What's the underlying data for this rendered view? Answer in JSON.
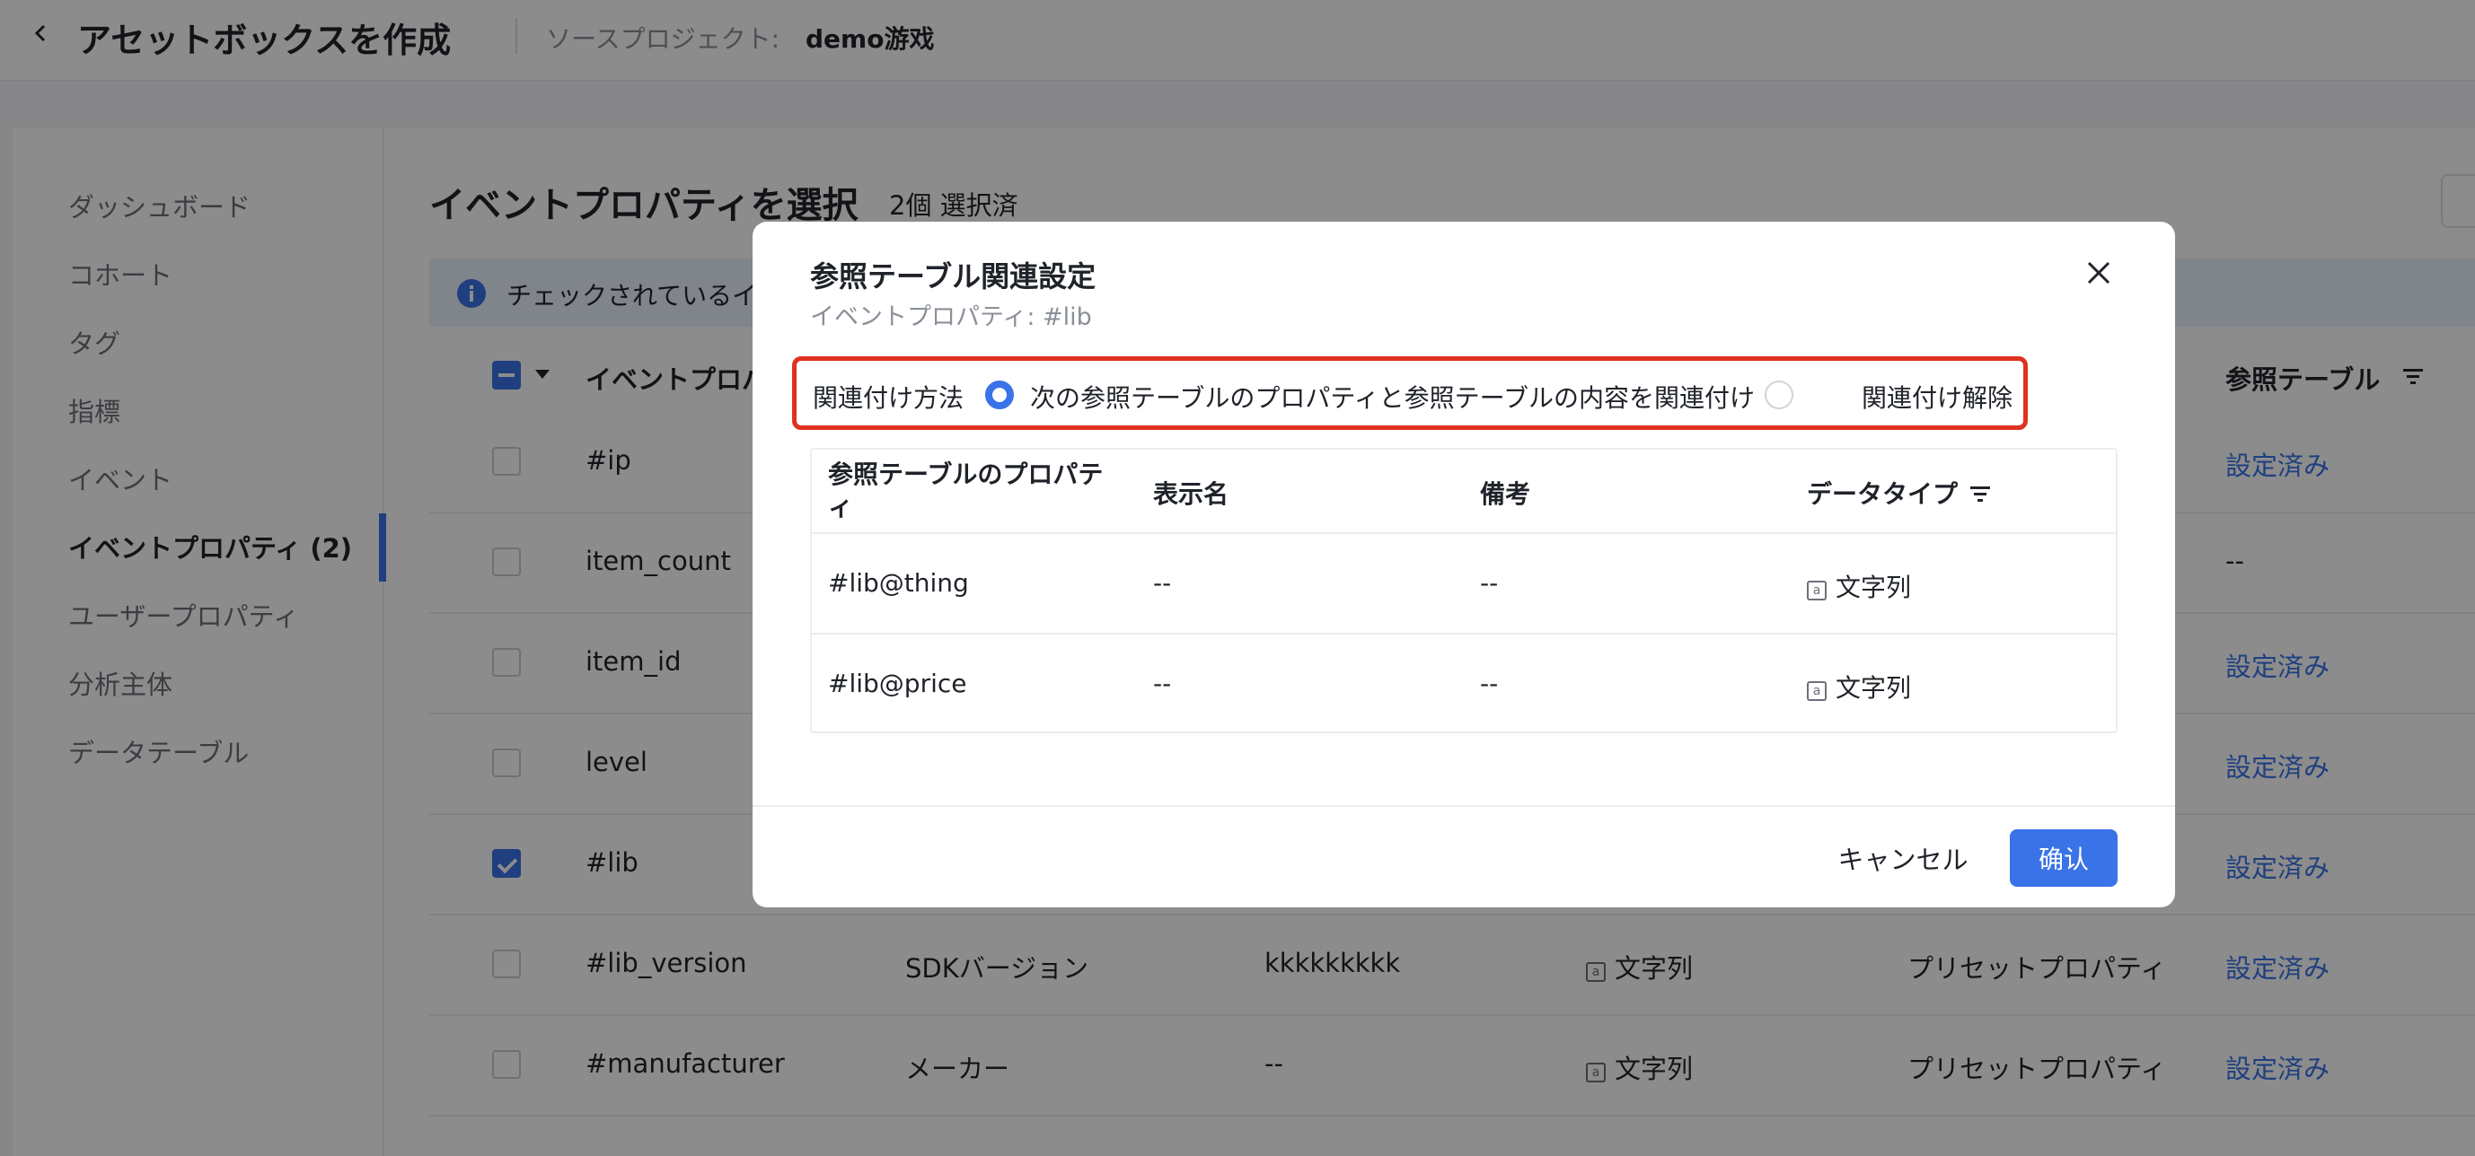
{
  "header": {
    "title": "アセットボックスを作成",
    "source_label": "ソースプロジェクト:",
    "source_value": "demo游戏"
  },
  "sidebar": {
    "items": [
      {
        "label": "ダッシュボード",
        "active": false
      },
      {
        "label": "コホート",
        "active": false
      },
      {
        "label": "タグ",
        "active": false
      },
      {
        "label": "指標",
        "active": false
      },
      {
        "label": "イベント",
        "active": false
      },
      {
        "label": "イベントプロパティ (2)",
        "active": true
      },
      {
        "label": "ユーザープロパティ",
        "active": false
      },
      {
        "label": "分析主体",
        "active": false
      },
      {
        "label": "データテーブル",
        "active": false
      }
    ]
  },
  "content": {
    "title": "イベントプロパティを選択",
    "selected_count": "2個 選択済",
    "info_text": "チェックされているイ",
    "header_col1": "イベントプロパテ",
    "header_ref": "参照テーブル",
    "rows": [
      {
        "name": "#ip",
        "checked": false,
        "display": "",
        "note": "",
        "type": "",
        "kind": "",
        "ref": "設定済み"
      },
      {
        "name": "item_count",
        "checked": false,
        "display": "",
        "note": "",
        "type": "",
        "kind": "",
        "ref": "--"
      },
      {
        "name": "item_id",
        "checked": false,
        "display": "",
        "note": "",
        "type": "",
        "kind": "",
        "ref": "設定済み"
      },
      {
        "name": "level",
        "checked": false,
        "display": "",
        "note": "",
        "type": "",
        "kind": "",
        "ref": "設定済み"
      },
      {
        "name": "#lib",
        "checked": true,
        "display": "",
        "note": "",
        "type": "",
        "kind": "",
        "ref": "設定済み"
      },
      {
        "name": "#lib_version",
        "checked": false,
        "display": "SDKバージョン",
        "note": "kkkkkkkkk",
        "type": "文字列",
        "kind": "プリセットプロパティ",
        "ref": "設定済み"
      },
      {
        "name": "#manufacturer",
        "checked": false,
        "display": "メーカー",
        "note": "--",
        "type": "文字列",
        "kind": "プリセットプロパティ",
        "ref": "設定済み"
      }
    ]
  },
  "modal": {
    "title": "参照テーブル関連設定",
    "subtitle": "イベントプロパティ: #lib",
    "assoc_label": "関連付け方法",
    "option_associate": "次の参照テーブルのプロパティと参照テーブルの内容を関連付け",
    "option_unlink": "関連付け解除",
    "selected_option": "associate",
    "table": {
      "headers": [
        "参照テーブルのプロパティ",
        "表示名",
        "備考",
        "データタイプ"
      ],
      "rows": [
        [
          "#lib@thing",
          "--",
          "--",
          "文字列"
        ],
        [
          "#lib@price",
          "--",
          "--",
          "文字列"
        ]
      ]
    },
    "cancel_label": "キャンセル",
    "confirm_label": "确认"
  },
  "icons": {
    "back": "chevron-left-icon",
    "info": "info-icon",
    "close": "close-icon",
    "filter": "filter-icon",
    "type": "string-type-icon"
  },
  "colors": {
    "accent": "#3a73e8",
    "highlight_border": "#e0321e",
    "overlay": "rgba(0,0,0,0.45)"
  }
}
